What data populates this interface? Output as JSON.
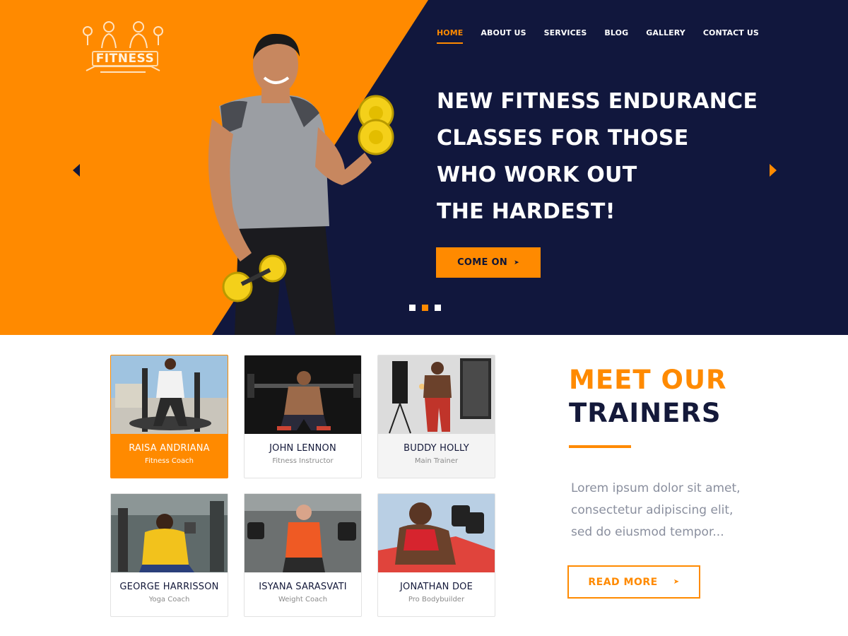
{
  "brand": {
    "logo_text": "FITNESS"
  },
  "nav": {
    "items": [
      {
        "label": "HOME",
        "active": true
      },
      {
        "label": "ABOUT US",
        "active": false
      },
      {
        "label": "SERVICES",
        "active": false
      },
      {
        "label": "BLOG",
        "active": false
      },
      {
        "label": "GALLERY",
        "active": false
      },
      {
        "label": "CONTACT US",
        "active": false
      }
    ]
  },
  "hero": {
    "headline_lines": [
      "NEW FITNESS ENDURANCE",
      "CLASSES FOR THOSE",
      "WHO WORK OUT",
      "THE HARDEST!"
    ],
    "cta_label": "COME ON",
    "slide_count": 3,
    "active_slide": 2
  },
  "trainers": [
    {
      "name": "RAISA ANDRIANA",
      "role": "Fitness Coach"
    },
    {
      "name": "JOHN LENNON",
      "role": "Fitness Instructor"
    },
    {
      "name": "BUDDY HOLLY",
      "role": "Main Trainer"
    },
    {
      "name": "GEORGE HARRISSON",
      "role": "Yoga Coach"
    },
    {
      "name": "ISYANA SARASVATI",
      "role": "Weight Coach"
    },
    {
      "name": "JONATHAN DOE",
      "role": "Pro Bodybuilder"
    }
  ],
  "section": {
    "title_line1": "MEET OUR",
    "title_line2": "TRAINERS",
    "description_lines": [
      "Lorem ipsum dolor sit amet,",
      "consectetur adipiscing elit,",
      "sed do eiusmod tempor..."
    ],
    "read_more_label": "READ MORE"
  },
  "colors": {
    "accent": "#ff8a00",
    "navy": "#11173d",
    "text_dark": "#14193a",
    "text_muted": "#8a8f9e"
  }
}
